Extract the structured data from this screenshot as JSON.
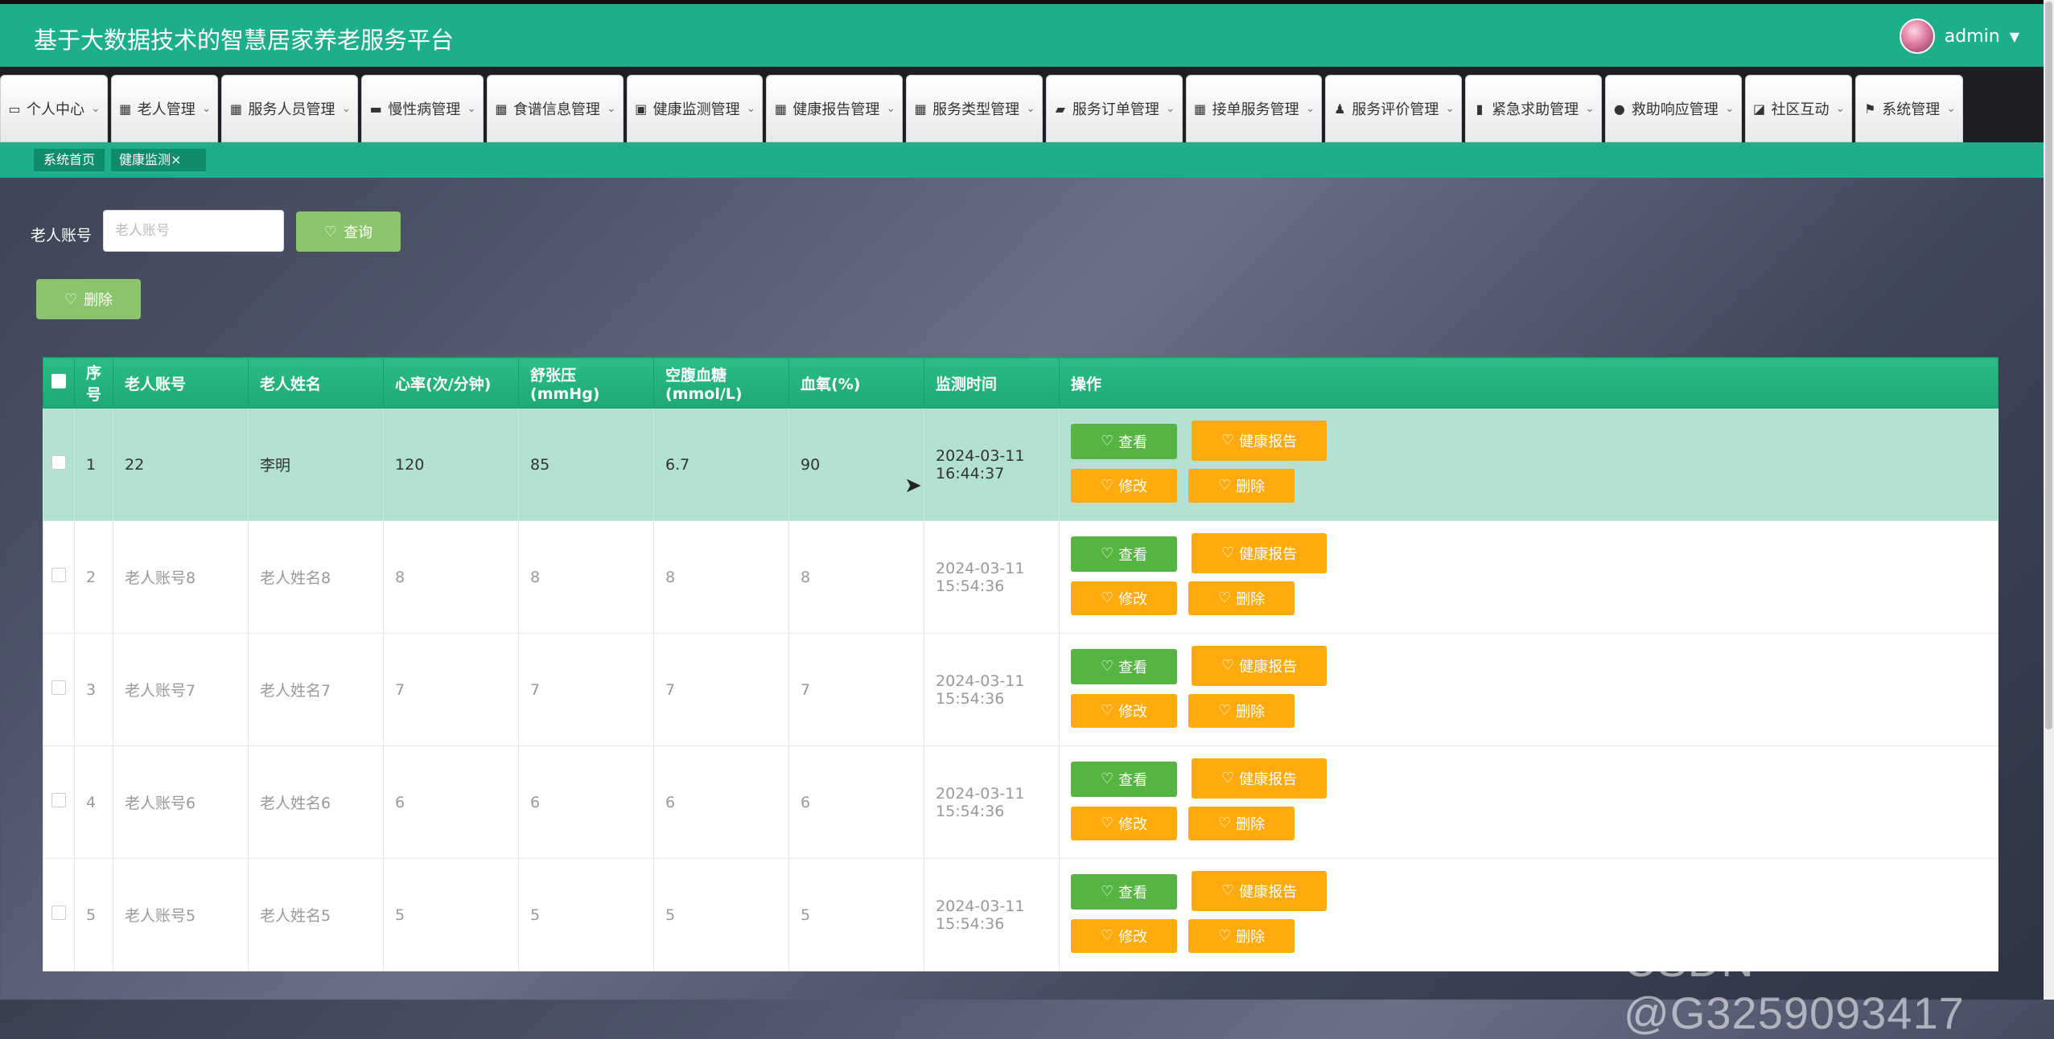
{
  "header": {
    "title": "基于大数据技术的智慧居家养老服务平台",
    "user": "admin"
  },
  "nav": [
    {
      "icon": "window-icon",
      "glyph": "▭",
      "label": "个人中心"
    },
    {
      "icon": "grid-icon",
      "glyph": "▦",
      "label": "老人管理"
    },
    {
      "icon": "grid-icon",
      "glyph": "▦",
      "label": "服务人员管理"
    },
    {
      "icon": "chat-icon",
      "glyph": "▬",
      "label": "慢性病管理"
    },
    {
      "icon": "grid-icon",
      "glyph": "▦",
      "label": "食谱信息管理"
    },
    {
      "icon": "calendar-icon",
      "glyph": "▣",
      "label": "健康监测管理"
    },
    {
      "icon": "grid-icon",
      "glyph": "▦",
      "label": "健康报告管理"
    },
    {
      "icon": "grid-icon",
      "glyph": "▦",
      "label": "服务类型管理"
    },
    {
      "icon": "briefcase-icon",
      "glyph": "▰",
      "label": "服务订单管理"
    },
    {
      "icon": "grid-icon",
      "glyph": "▦",
      "label": "接单服务管理"
    },
    {
      "icon": "user-icon",
      "glyph": "♟",
      "label": "服务评价管理"
    },
    {
      "icon": "bar-chart-icon",
      "glyph": "▮",
      "label": "紧急求助管理"
    },
    {
      "icon": "pin-icon",
      "glyph": "●",
      "label": "救助响应管理"
    },
    {
      "icon": "line-chart-icon",
      "glyph": "◪",
      "label": "社区互动"
    },
    {
      "icon": "flag-icon",
      "glyph": "⚑",
      "label": "系统管理"
    }
  ],
  "tabs": {
    "home": "系统首页",
    "current": "健康监测×"
  },
  "search": {
    "label": "老人账号",
    "placeholder": "老人账号",
    "query_btn": "查询",
    "delete_btn": "删除"
  },
  "table": {
    "headers": [
      "序号",
      "老人账号",
      "老人姓名",
      "心率(次/分钟)",
      "舒张压(mmHg)",
      "空腹血糖(mmol/L)",
      "血氧(%)",
      "监测时间",
      "操作"
    ],
    "rows": [
      {
        "no": "1",
        "account": "22",
        "name": "李明",
        "heart": "120",
        "diastolic": "85",
        "glucose": "6.7",
        "oxygen": "90",
        "time": "2024-03-11 16:44:37"
      },
      {
        "no": "2",
        "account": "老人账号8",
        "name": "老人姓名8",
        "heart": "8",
        "diastolic": "8",
        "glucose": "8",
        "oxygen": "8",
        "time": "2024-03-11 15:54:36"
      },
      {
        "no": "3",
        "account": "老人账号7",
        "name": "老人姓名7",
        "heart": "7",
        "diastolic": "7",
        "glucose": "7",
        "oxygen": "7",
        "time": "2024-03-11 15:54:36"
      },
      {
        "no": "4",
        "account": "老人账号6",
        "name": "老人姓名6",
        "heart": "6",
        "diastolic": "6",
        "glucose": "6",
        "oxygen": "6",
        "time": "2024-03-11 15:54:36"
      },
      {
        "no": "5",
        "account": "老人账号5",
        "name": "老人姓名5",
        "heart": "5",
        "diastolic": "5",
        "glucose": "5",
        "oxygen": "5",
        "time": "2024-03-11 15:54:36"
      }
    ],
    "actions": {
      "view": "查看",
      "report": "健康报告",
      "edit": "修改",
      "delete": "删除"
    }
  },
  "watermark": "CSDN @G3259093417"
}
